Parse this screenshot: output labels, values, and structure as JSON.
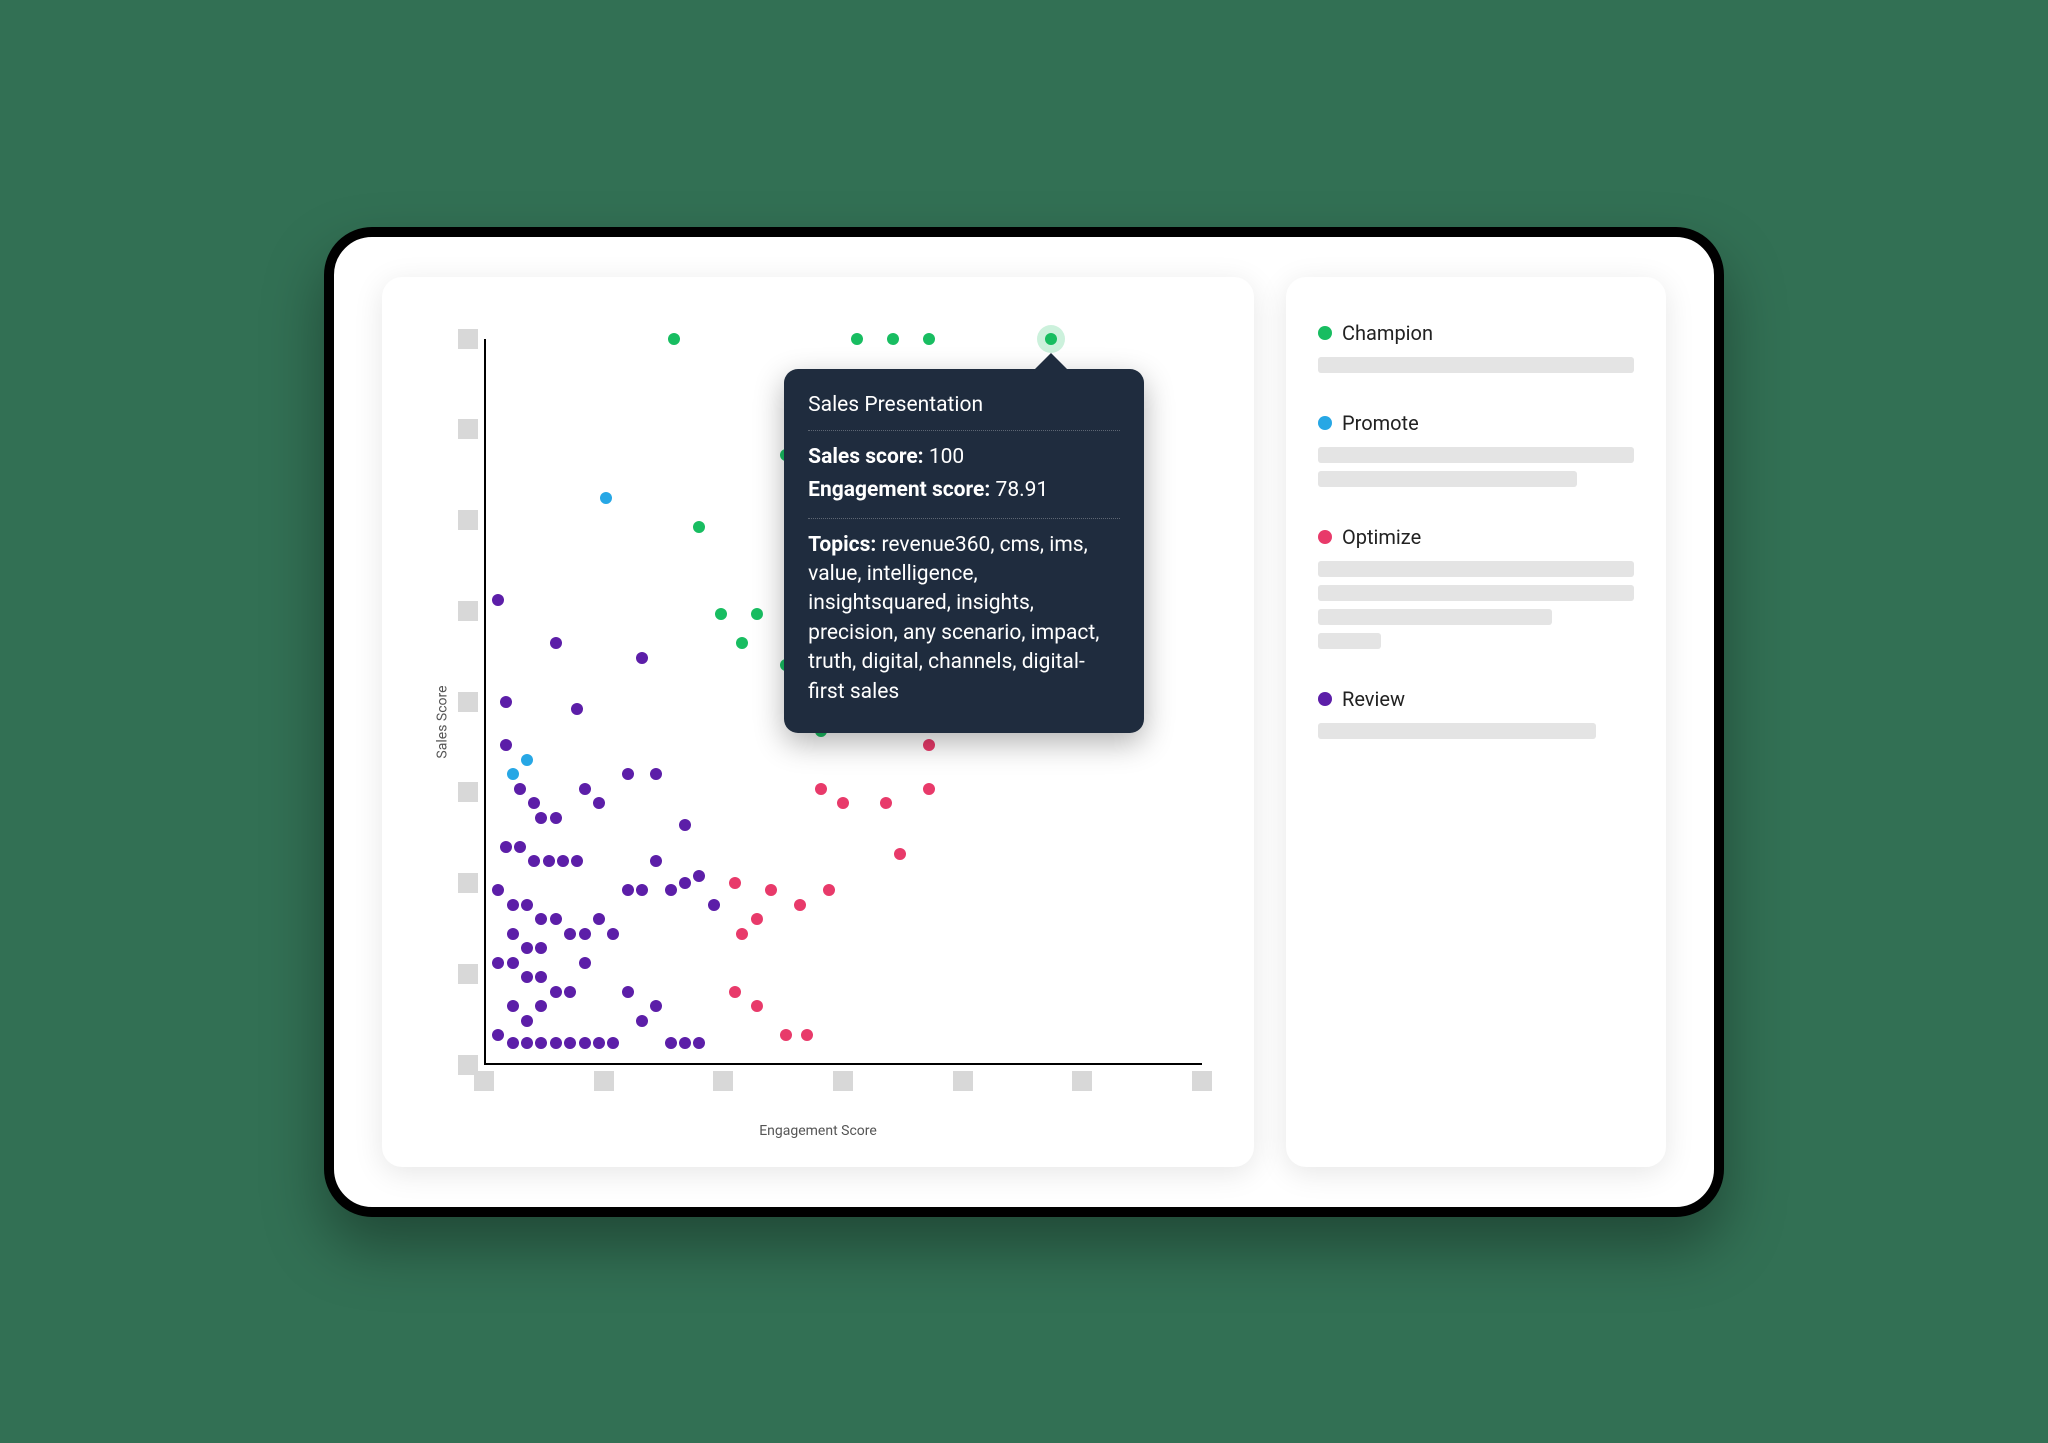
{
  "colors": {
    "champion": "#18bd61",
    "promote": "#27a7e5",
    "optimize": "#e83a6a",
    "review": "#5c1ea8"
  },
  "chart_data": {
    "type": "scatter",
    "title": "",
    "xlabel": "Engagement Score",
    "ylabel": "Sales Score",
    "xlim": [
      0,
      100
    ],
    "ylim": [
      0,
      100
    ],
    "x_ticks": [
      0,
      16.67,
      33.33,
      50,
      66.67,
      83.33,
      100
    ],
    "y_ticks": [
      0,
      12.5,
      25,
      37.5,
      50,
      62.5,
      75,
      87.5,
      100
    ],
    "series": [
      {
        "name": "Champion",
        "color": "#18bd61",
        "points": [
          {
            "x": 26.5,
            "y": 100
          },
          {
            "x": 52,
            "y": 100
          },
          {
            "x": 57,
            "y": 100
          },
          {
            "x": 62,
            "y": 100
          },
          {
            "x": 78.91,
            "y": 100,
            "highlight": true,
            "tooltip": true
          },
          {
            "x": 45,
            "y": 78
          },
          {
            "x": 50,
            "y": 78
          },
          {
            "x": 53,
            "y": 73
          },
          {
            "x": 54,
            "y": 70
          },
          {
            "x": 46,
            "y": 68
          },
          {
            "x": 33,
            "y": 62
          },
          {
            "x": 36,
            "y": 58
          },
          {
            "x": 38,
            "y": 62
          },
          {
            "x": 42,
            "y": 55
          },
          {
            "x": 30,
            "y": 74
          },
          {
            "x": 42,
            "y": 84
          },
          {
            "x": 56,
            "y": 62
          },
          {
            "x": 50,
            "y": 50
          },
          {
            "x": 47,
            "y": 46
          }
        ]
      },
      {
        "name": "Promote",
        "color": "#27a7e5",
        "points": [
          {
            "x": 17,
            "y": 78
          },
          {
            "x": 6,
            "y": 42
          },
          {
            "x": 4,
            "y": 40
          }
        ]
      },
      {
        "name": "Optimize",
        "color": "#e83a6a",
        "points": [
          {
            "x": 47,
            "y": 38
          },
          {
            "x": 50,
            "y": 36
          },
          {
            "x": 56,
            "y": 36
          },
          {
            "x": 62,
            "y": 38
          },
          {
            "x": 58,
            "y": 29
          },
          {
            "x": 48,
            "y": 24
          },
          {
            "x": 44,
            "y": 22
          },
          {
            "x": 40,
            "y": 24
          },
          {
            "x": 38,
            "y": 20
          },
          {
            "x": 36,
            "y": 18
          },
          {
            "x": 35,
            "y": 10
          },
          {
            "x": 38,
            "y": 8
          },
          {
            "x": 42,
            "y": 4
          },
          {
            "x": 45,
            "y": 4
          },
          {
            "x": 35,
            "y": 25
          },
          {
            "x": 62,
            "y": 44
          }
        ]
      },
      {
        "name": "Review",
        "color": "#5c1ea8",
        "points": [
          {
            "x": 2,
            "y": 64
          },
          {
            "x": 10,
            "y": 58
          },
          {
            "x": 22,
            "y": 56
          },
          {
            "x": 3,
            "y": 44
          },
          {
            "x": 5,
            "y": 38
          },
          {
            "x": 7,
            "y": 36
          },
          {
            "x": 8,
            "y": 34
          },
          {
            "x": 10,
            "y": 34
          },
          {
            "x": 14,
            "y": 38
          },
          {
            "x": 16,
            "y": 36
          },
          {
            "x": 20,
            "y": 40
          },
          {
            "x": 24,
            "y": 40
          },
          {
            "x": 28,
            "y": 33
          },
          {
            "x": 3,
            "y": 30
          },
          {
            "x": 5,
            "y": 30
          },
          {
            "x": 7,
            "y": 28
          },
          {
            "x": 9,
            "y": 28
          },
          {
            "x": 11,
            "y": 28
          },
          {
            "x": 13,
            "y": 28
          },
          {
            "x": 2,
            "y": 24
          },
          {
            "x": 4,
            "y": 22
          },
          {
            "x": 6,
            "y": 22
          },
          {
            "x": 8,
            "y": 20
          },
          {
            "x": 10,
            "y": 20
          },
          {
            "x": 12,
            "y": 18
          },
          {
            "x": 14,
            "y": 18
          },
          {
            "x": 16,
            "y": 20
          },
          {
            "x": 18,
            "y": 18
          },
          {
            "x": 20,
            "y": 24
          },
          {
            "x": 22,
            "y": 24
          },
          {
            "x": 24,
            "y": 28
          },
          {
            "x": 26,
            "y": 24
          },
          {
            "x": 28,
            "y": 25
          },
          {
            "x": 30,
            "y": 26
          },
          {
            "x": 32,
            "y": 22
          },
          {
            "x": 2,
            "y": 14
          },
          {
            "x": 4,
            "y": 14
          },
          {
            "x": 6,
            "y": 12
          },
          {
            "x": 8,
            "y": 12
          },
          {
            "x": 10,
            "y": 10
          },
          {
            "x": 12,
            "y": 10
          },
          {
            "x": 14,
            "y": 14
          },
          {
            "x": 16,
            "y": 3
          },
          {
            "x": 18,
            "y": 3
          },
          {
            "x": 20,
            "y": 10
          },
          {
            "x": 22,
            "y": 6
          },
          {
            "x": 24,
            "y": 8
          },
          {
            "x": 26,
            "y": 3
          },
          {
            "x": 28,
            "y": 3
          },
          {
            "x": 30,
            "y": 3
          },
          {
            "x": 2,
            "y": 4
          },
          {
            "x": 4,
            "y": 3
          },
          {
            "x": 6,
            "y": 3
          },
          {
            "x": 8,
            "y": 3
          },
          {
            "x": 10,
            "y": 3
          },
          {
            "x": 12,
            "y": 3
          },
          {
            "x": 14,
            "y": 3
          },
          {
            "x": 4,
            "y": 8
          },
          {
            "x": 6,
            "y": 6
          },
          {
            "x": 8,
            "y": 8
          },
          {
            "x": 4,
            "y": 18
          },
          {
            "x": 6,
            "y": 16
          },
          {
            "x": 8,
            "y": 16
          },
          {
            "x": 3,
            "y": 50
          },
          {
            "x": 13,
            "y": 49
          }
        ]
      }
    ]
  },
  "tooltip": {
    "title": "Sales Presentation",
    "sales_label": "Sales score:",
    "sales_value": "100",
    "engagement_label": "Engagement score:",
    "engagement_value": "78.91",
    "topics_label": "Topics:",
    "topics_value": "revenue360, cms, ims, value, intelligence, insightsquared, insights, precision, any scenario, impact, truth, digital, channels, digital-first sales"
  },
  "legend": {
    "items": [
      {
        "label": "Champion",
        "color": "#18bd61",
        "skeletons": [
          100
        ]
      },
      {
        "label": "Promote",
        "color": "#27a7e5",
        "skeletons": [
          100,
          82
        ]
      },
      {
        "label": "Optimize",
        "color": "#e83a6a",
        "skeletons": [
          100,
          100,
          74,
          20
        ]
      },
      {
        "label": "Review",
        "color": "#5c1ea8",
        "skeletons": [
          88
        ]
      }
    ]
  }
}
